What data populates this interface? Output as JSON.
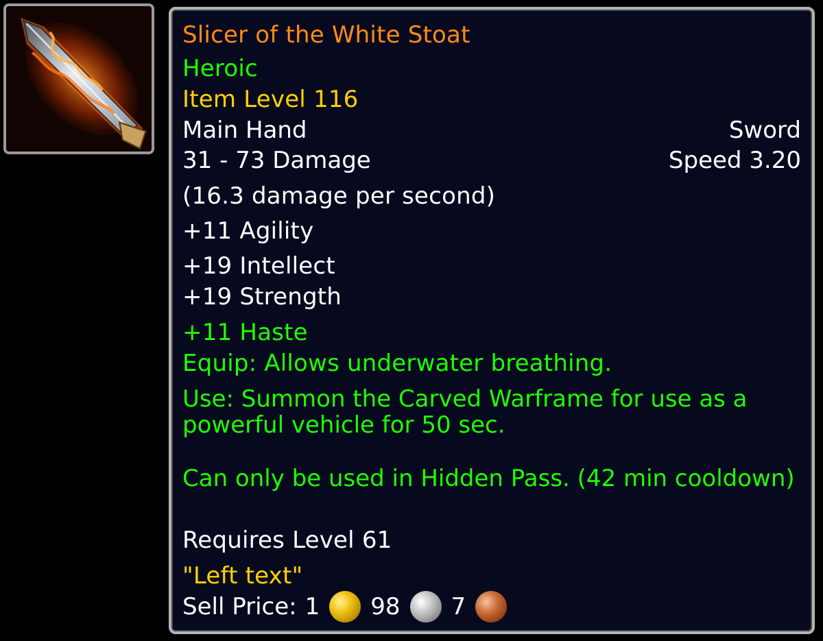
{
  "item": {
    "name": "Slicer of the White Stoat",
    "difficulty": "Heroic",
    "item_level": "Item Level 116",
    "slot": "Main Hand",
    "type": "Sword",
    "damage": "31 - 73 Damage",
    "speed": "Speed 3.20",
    "dps": "(16.3 damage per second)",
    "stats": {
      "agility": "+11 Agility",
      "intellect": "+19 Intellect",
      "strength": "+19 Strength",
      "haste": "+11 Haste"
    },
    "equip_effect": "Equip: Allows underwater breathing.",
    "use_effect": "Use: Summon the Carved Warframe for use as a powerful vehicle for 50 sec.",
    "use_restriction": "Can only be used in Hidden Pass. (42 min cooldown)",
    "required_level": "Requires Level 61",
    "flavor_text": "\"Left text\"",
    "sell_price": {
      "label": "Sell Price:",
      "gold": "1",
      "silver": "98",
      "copper": "7"
    },
    "icon": "flaming-sword-icon"
  },
  "colors": {
    "name": "#ff8a1a",
    "green": "#1eff00",
    "gold": "#ffd100",
    "white": "#ffffff",
    "background": "#070a1f"
  }
}
